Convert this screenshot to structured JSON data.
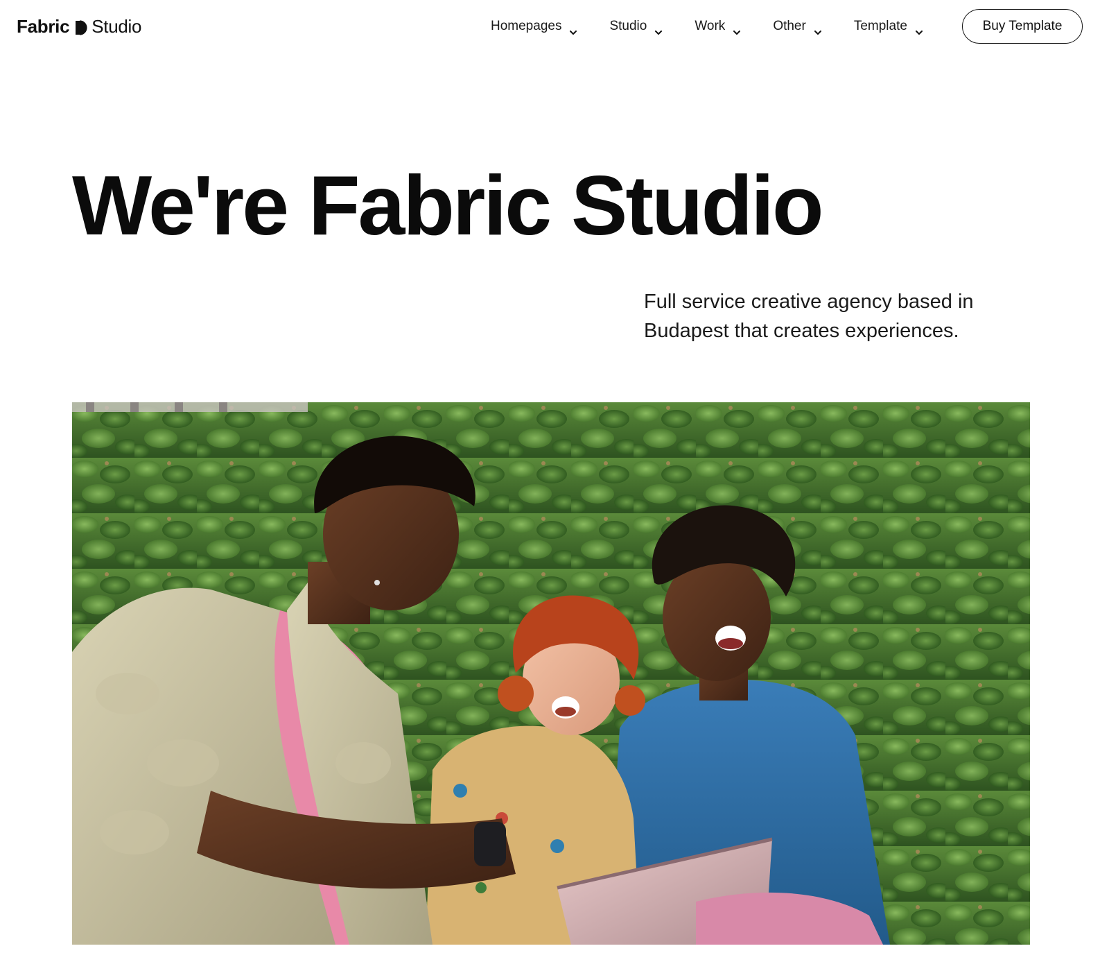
{
  "brand": {
    "name_bold": "Fabric",
    "name_light": "Studio",
    "mark_icon": "half-circle-mark-icon"
  },
  "nav": {
    "items": [
      {
        "label": "Homepages",
        "icon": "chevron-down-icon"
      },
      {
        "label": "Studio",
        "icon": "chevron-down-icon"
      },
      {
        "label": "Work",
        "icon": "chevron-down-icon"
      },
      {
        "label": "Other",
        "icon": "chevron-down-icon"
      },
      {
        "label": "Template",
        "icon": "chevron-down-icon"
      }
    ],
    "cta_label": "Buy Template"
  },
  "hero": {
    "title": "We're Fabric Studio",
    "subtitle": "Full service creative agency based in Budapest that creates experiences."
  },
  "colors": {
    "text": "#111111",
    "background": "#ffffff",
    "foliage": "#3f6b2a",
    "accent_pink": "#e889a8",
    "accent_blue": "#2f6fa6"
  }
}
